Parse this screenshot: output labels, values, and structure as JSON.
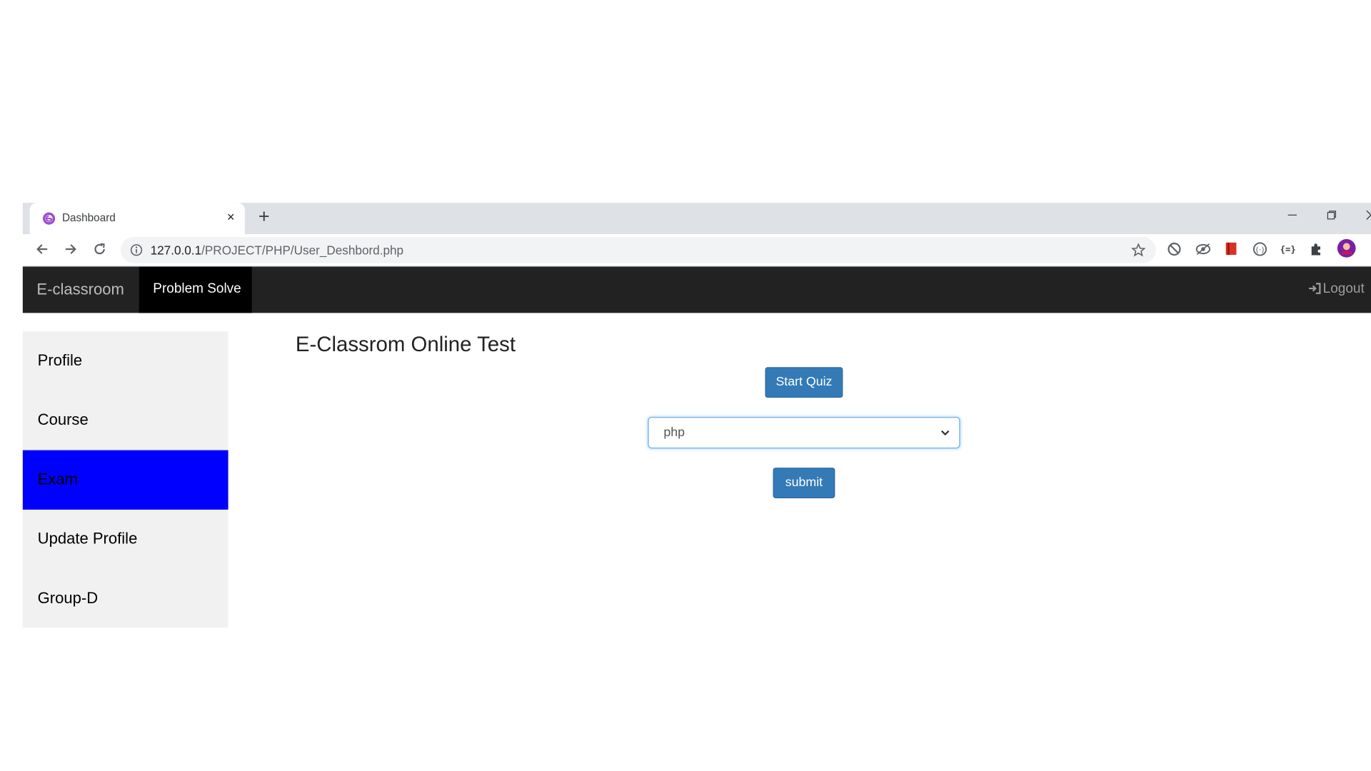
{
  "browser": {
    "tab_title": "Dashboard",
    "tab_close": "×",
    "new_tab": "+",
    "url_host": "127.0.0.1",
    "url_path": "/PROJECT/PHP/User_Deshbord.php"
  },
  "navbar": {
    "brand": "E-classroom",
    "active_item": "Problem Solve",
    "logout": "Logout"
  },
  "sidebar": {
    "items": [
      {
        "label": "Profile"
      },
      {
        "label": "Course"
      },
      {
        "label": "Exam",
        "active": true
      },
      {
        "label": "Update Profile"
      },
      {
        "label": "Group-D"
      }
    ],
    "active_color": "#0000ff"
  },
  "main": {
    "title": "E-Classrom Online Test",
    "start_quiz_label": "Start Quiz",
    "select_value": "php",
    "submit_label": "submit"
  },
  "colors": {
    "navbar_bg": "#222222",
    "button_primary": "#337ab7"
  }
}
